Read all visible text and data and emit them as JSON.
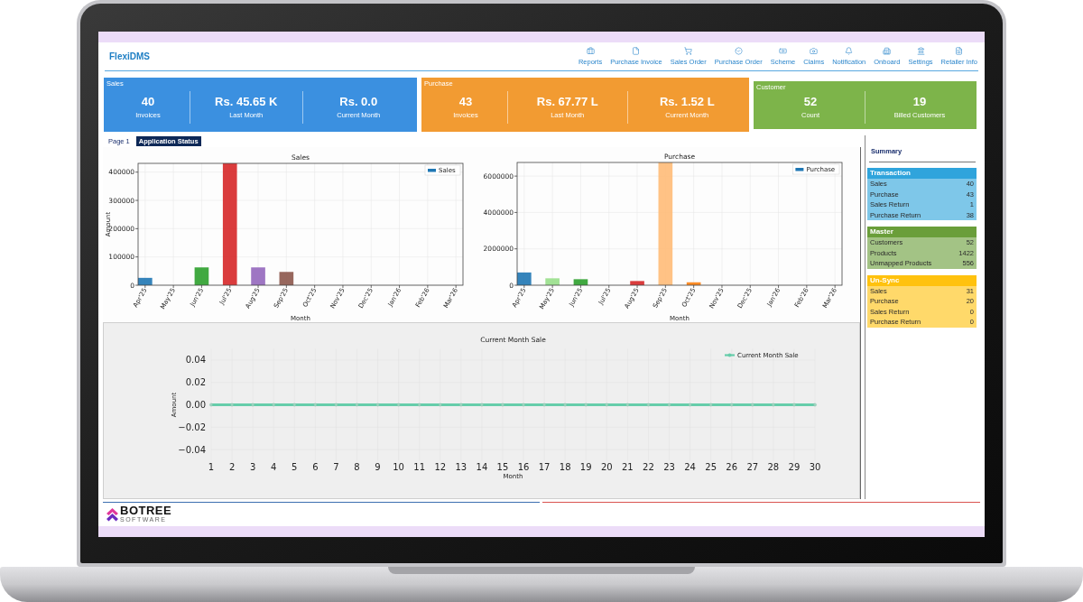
{
  "app": {
    "title": "FlexiDMS"
  },
  "nav": [
    {
      "label": "Reports"
    },
    {
      "label": "Purchase Invoice"
    },
    {
      "label": "Sales Order"
    },
    {
      "label": "Purchase Order"
    },
    {
      "label": "Scheme"
    },
    {
      "label": "Claims"
    },
    {
      "label": "Notification"
    },
    {
      "label": "Onboard"
    },
    {
      "label": "Settings"
    },
    {
      "label": "Retailer Info"
    }
  ],
  "stat_cards": [
    {
      "title": "Sales",
      "color": "#3b90e0",
      "stats": [
        {
          "value": "40",
          "label": "Invoices"
        },
        {
          "value": "Rs. 45.65 K",
          "label": "Last Month"
        },
        {
          "value": "Rs. 0.0",
          "label": "Current Month"
        }
      ]
    },
    {
      "title": "Purchase",
      "color": "#f29b32",
      "stats": [
        {
          "value": "43",
          "label": "Invoices"
        },
        {
          "value": "Rs. 67.77 L",
          "label": "Last Month"
        },
        {
          "value": "Rs. 1.52 L",
          "label": "Current Month"
        }
      ]
    },
    {
      "title": "Customer",
      "color": "#7db44a",
      "stats": [
        {
          "value": "52",
          "label": "Count"
        },
        {
          "value": "19",
          "label": "Billed Customers"
        }
      ]
    }
  ],
  "tabs": [
    {
      "label": "Page 1",
      "selected": false
    },
    {
      "label": "Application Status",
      "selected": true
    }
  ],
  "charts": [
    {
      "chart_data": {
        "type": "bar",
        "title": "Sales",
        "xlabel": "Month",
        "ylabel": "Amount",
        "categories": [
          "Apr'25",
          "May'25",
          "Jun'25",
          "Jul'25",
          "Aug'25",
          "Sep'25",
          "Oct'25",
          "Nov'25",
          "Dec'25",
          "Jan'26",
          "Feb'26",
          "Mar'26"
        ],
        "series": [
          {
            "name": "Sales",
            "color": "#1f77b4",
            "values": [
              26000,
              0,
              63000,
              431000,
              63000,
              47000,
              0,
              0,
              0,
              0,
              0,
              0
            ],
            "colors": [
              "#1f77b4",
              null,
              "#2ca02c",
              "#d62728",
              "#9467bd",
              "#8c564b",
              null,
              null,
              null,
              null,
              null,
              null
            ]
          }
        ],
        "ylim": [
          0,
          431000
        ],
        "yticks": [
          0,
          100000,
          200000,
          300000,
          400000
        ],
        "grid": true
      }
    },
    {
      "chart_data": {
        "type": "bar",
        "title": "Purchase",
        "xlabel": "Month",
        "categories": [
          "Apr'25",
          "May'25",
          "Jun'25",
          "Jul'25",
          "Aug'25",
          "Sep'25",
          "Oct'25",
          "Nov'25",
          "Dec'25",
          "Jan'26",
          "Feb'26",
          "Mar'26"
        ],
        "series": [
          {
            "name": "Purchase",
            "color": "#1f77b4",
            "values": [
              700000,
              380000,
              330000,
              0,
              230000,
              6750000,
              160000,
              0,
              0,
              0,
              0,
              0
            ],
            "colors": [
              "#1f77b4",
              "#98df8a",
              "#2ca02c",
              null,
              "#d62728",
              "#ffbb78",
              "#ff7f0e",
              null,
              null,
              null,
              null,
              null
            ]
          }
        ],
        "ylim": [
          0,
          6750000
        ],
        "yticks": [
          0,
          2000000,
          4000000,
          6000000
        ],
        "grid": true
      }
    },
    {
      "chart_data": {
        "type": "line",
        "title": "Current Month Sale",
        "xlabel": "Month",
        "ylabel": "Amount",
        "x": [
          1,
          2,
          3,
          4,
          5,
          6,
          7,
          8,
          9,
          10,
          11,
          12,
          13,
          14,
          15,
          16,
          17,
          18,
          19,
          20,
          21,
          22,
          23,
          24,
          25,
          26,
          27,
          28,
          29,
          30
        ],
        "series": [
          {
            "name": "Current Month Sale",
            "color": "#66cdaa",
            "marker": "o",
            "values": [
              0,
              0,
              0,
              0,
              0,
              0,
              0,
              0,
              0,
              0,
              0,
              0,
              0,
              0,
              0,
              0,
              0,
              0,
              0,
              0,
              0,
              0,
              0,
              0,
              0,
              0,
              0,
              0,
              0,
              0
            ]
          }
        ],
        "xlim": [
          1,
          30
        ],
        "ylim": [
          -0.05,
          0.05
        ],
        "xticks": [
          1,
          2,
          3,
          4,
          5,
          6,
          7,
          8,
          9,
          10,
          11,
          12,
          13,
          14,
          15,
          16,
          17,
          18,
          19,
          20,
          21,
          22,
          23,
          24,
          25,
          26,
          27,
          28,
          29,
          30
        ],
        "yticks": [
          {
            "value": -0.04,
            "label": "−0.04"
          },
          {
            "value": -0.02,
            "label": "−0.02"
          },
          {
            "value": 0,
            "label": "0.00"
          },
          {
            "value": 0.02,
            "label": "0.02"
          },
          {
            "value": 0.04,
            "label": "0.04"
          }
        ],
        "grid": true
      }
    }
  ],
  "summary": {
    "title": "Summary",
    "groups": [
      {
        "title": "Transaction",
        "color": "#2fa4dc",
        "rows": [
          {
            "label": "Sales",
            "value": "40"
          },
          {
            "label": "Purchase",
            "value": "43"
          },
          {
            "label": "Sales Return",
            "value": "1"
          },
          {
            "label": "Purchase Return",
            "value": "38"
          }
        ]
      },
      {
        "title": "Master",
        "color": "#6a9e3a",
        "rows": [
          {
            "label": "Customers",
            "value": "52"
          },
          {
            "label": "Products",
            "value": "1422"
          },
          {
            "label": "Unmapped Products",
            "value": "556"
          }
        ]
      },
      {
        "title": "Un-Sync",
        "color": "#ffc20e",
        "rows": [
          {
            "label": "Sales",
            "value": "31"
          },
          {
            "label": "Purchase",
            "value": "20"
          },
          {
            "label": "Sales Return",
            "value": "0"
          },
          {
            "label": "Purchase Return",
            "value": "0"
          }
        ]
      }
    ]
  },
  "footer": {
    "logo": "BOTREE",
    "tagline": "SOFTWARE"
  }
}
